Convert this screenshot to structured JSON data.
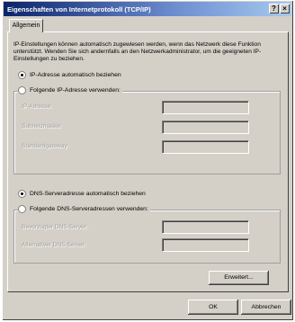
{
  "window": {
    "title": "Eigenschaften von Internetprotokoll (TCP/IP)",
    "help_label": "?",
    "close_label": "×"
  },
  "tabs": [
    {
      "label": "Allgemein",
      "active": true
    }
  ],
  "intro_text": "IP-Einstellungen können automatisch zugewiesen werden, wenn das Netzwerk diese Funktion unterstützt. Wenden Sie sich andernfalls an den Netzwerkadministrator, um die geeigneten IP-Einstellungen zu beziehen.",
  "ip": {
    "auto_label": "IP-Adresse automatisch beziehen",
    "manual_label": "Folgende IP-Adresse verwenden:",
    "selected": "auto",
    "fields": [
      {
        "label": "IP-Adresse:",
        "value": ""
      },
      {
        "label": "Subnetzmaske:",
        "value": ""
      },
      {
        "label": "Standardgateway:",
        "value": ""
      }
    ]
  },
  "dns": {
    "auto_label": "DNS-Serveradresse automatisch beziehen",
    "manual_label": "Folgende DNS-Serveradressen verwenden:",
    "selected": "auto",
    "fields": [
      {
        "label": "Bevorzugter DNS-Server:",
        "value": ""
      },
      {
        "label": "Alternativer DNS-Server:",
        "value": ""
      }
    ]
  },
  "buttons": {
    "advanced": "Erweitert...",
    "ok": "OK",
    "cancel": "Abbrechen"
  },
  "colors": {
    "face": "#d4d0c8",
    "title_start": "#0a246a",
    "title_end": "#a6caf0"
  }
}
